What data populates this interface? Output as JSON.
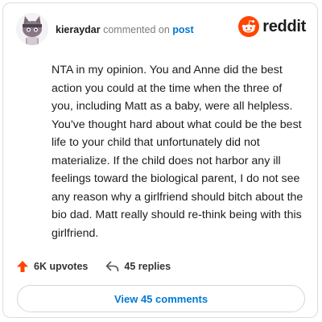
{
  "comment": {
    "username": "kieraydar",
    "verb": "commented on",
    "target": "post",
    "text": "NTA in my opinion. You and Anne did the best action you could at the time when the three of you, including Matt as a baby, were all helpless. You've thought hard about what could be the best life to your child that unfortunately did not materialize. If the child does not harbor any ill feelings toward the biological parent, I do not see any reason why a girlfriend should bitch about the bio dad. Matt really should re-think being with this girlfriend."
  },
  "brand": {
    "wordmark": "reddit",
    "icon": "reddit-logo-icon",
    "color": "#ff4500"
  },
  "stats": {
    "upvotes": "6K upvotes",
    "replies": "45 replies",
    "upvote_icon": "upvote-arrow-icon",
    "reply_icon": "reply-arrow-icon"
  },
  "cta": {
    "view_label": "View 45 comments"
  },
  "colors": {
    "accent_blue": "#0079d3",
    "upvote_orange": "#ff4500",
    "text": "#1c1c1c",
    "muted": "#7c7c7c"
  }
}
